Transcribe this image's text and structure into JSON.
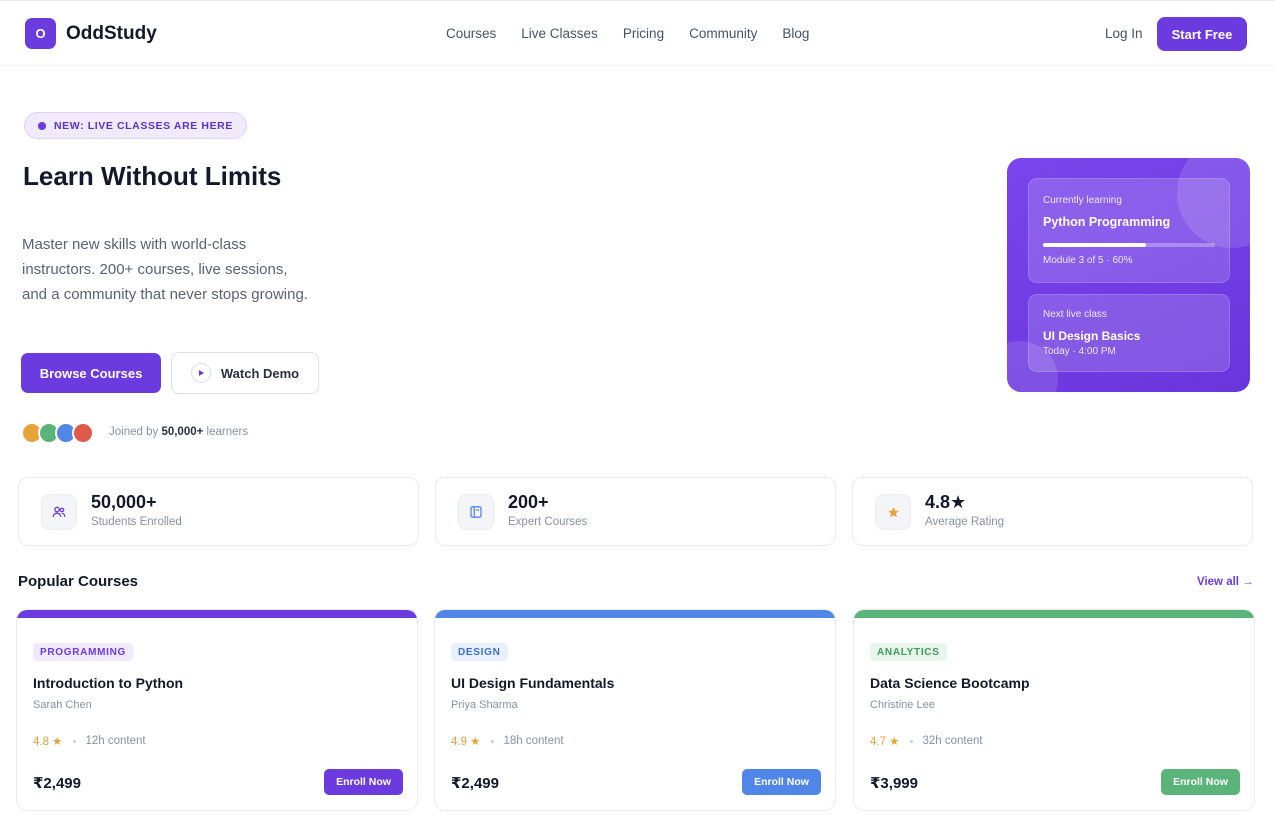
{
  "header": {
    "logo_mark": "O",
    "logo_text": "OddStudy",
    "nav": [
      "Courses",
      "Live Classes",
      "Pricing",
      "Community",
      "Blog"
    ],
    "login": "Log In",
    "cta": "Start Free"
  },
  "hero": {
    "badge": "NEW: LIVE CLASSES ARE HERE",
    "title": "Learn Without Limits",
    "subtitle": "Master new skills with world-class instructors. 200+ courses, live sessions, and a community that never stops growing.",
    "primary_button": "Browse Courses",
    "secondary_button": "Watch Demo",
    "joined_prefix": "Joined by",
    "joined_count": "50,000+",
    "joined_suffix": "learners",
    "avatar_colors": [
      "#e8a23a",
      "#5bb57a",
      "#4f86e8",
      "#e05a4a"
    ]
  },
  "learning_card": {
    "current_label": "Currently learning",
    "current_course": "Python Programming",
    "progress_text": "Module 3 of 5 · 60%",
    "progress": 0.6,
    "next_label": "Next live class",
    "next_class": "UI Design Basics",
    "next_time": "Today · 4:00 PM"
  },
  "stats": [
    {
      "icon": "users-icon",
      "value": "50,000+",
      "label": "Students Enrolled"
    },
    {
      "icon": "book-icon",
      "value": "200+",
      "label": "Expert Courses"
    },
    {
      "icon": "star-icon",
      "value": "4.8★",
      "label": "Average Rating"
    }
  ],
  "courses_section": {
    "title": "Popular Courses",
    "view_all": "View all →"
  },
  "courses": [
    {
      "tag": "PROGRAMMING",
      "title": "Introduction to Python",
      "instructor": "Sarah Chen",
      "rating": "4.8 ★",
      "hours": "12h content",
      "price": "₹2,499",
      "button": "Enroll Now",
      "color": "#6c3be0",
      "tag_bg": "#efeafe",
      "tag_color": "#6c3be0"
    },
    {
      "tag": "DESIGN",
      "title": "UI Design Fundamentals",
      "instructor": "Priya Sharma",
      "rating": "4.9 ★",
      "hours": "18h content",
      "price": "₹2,499",
      "button": "Enroll Now",
      "color": "#4f86e8",
      "tag_bg": "#e8f0fd",
      "tag_color": "#3b6fd0"
    },
    {
      "tag": "ANALYTICS",
      "title": "Data Science Bootcamp",
      "instructor": "Christine Lee",
      "rating": "4.7 ★",
      "hours": "32h content",
      "price": "₹3,999",
      "button": "Enroll Now",
      "color": "#5bb57a",
      "tag_bg": "#e7f5ec",
      "tag_color": "#3f9a5e"
    }
  ]
}
